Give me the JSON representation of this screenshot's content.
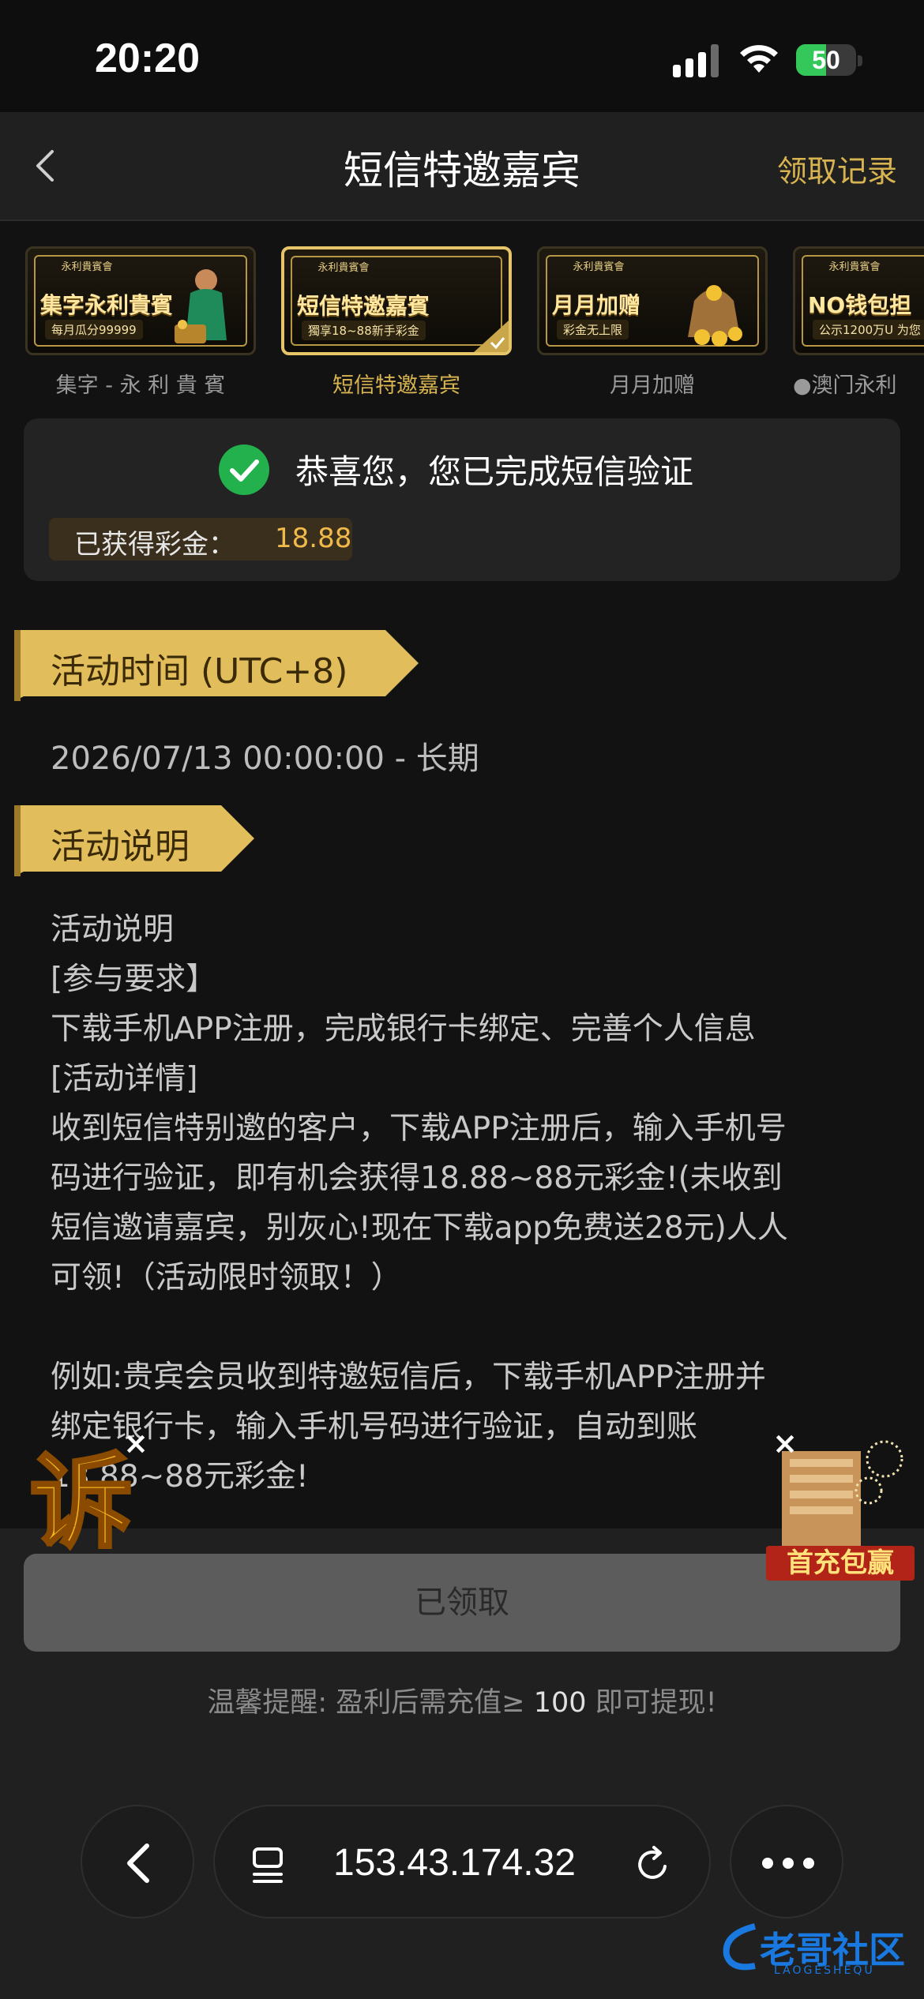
{
  "status_bar": {
    "time": "20:20",
    "battery": "50",
    "battery_level": 0.5
  },
  "header": {
    "title": "短信特邀嘉宾",
    "right_link": "领取记录"
  },
  "banners": [
    {
      "brand": "永利貴賓會",
      "main": "集字永利貴賓",
      "sub": "每月瓜分99999",
      "label": "集字 - 永 利 貴 賓"
    },
    {
      "brand": "永利貴賓會",
      "main": "短信特邀嘉賓",
      "sub": "獨享18~88新手彩金",
      "label": "短信特邀嘉宾"
    },
    {
      "brand": "永利貴賓會",
      "main": "月月加赠",
      "sub": "彩金无上限",
      "label": "月月加赠"
    },
    {
      "brand": "永利貴賓會",
      "main": "NO钱包担",
      "sub": "公示1200万U 为您",
      "label": "●澳门永利"
    }
  ],
  "verify": {
    "message": "恭喜您，您已完成短信验证",
    "bonus_label": "已获得彩金：",
    "bonus_value": "18.88"
  },
  "sections": {
    "time_title": "活动时间 (UTC+8)",
    "time_value": "2026/07/13 00:00:00 - 长期",
    "desc_title": "活动说明"
  },
  "description_lines": [
    "活动说明",
    "[参与要求】",
    "下载手机APP注册，完成银行卡绑定、完善个人信息",
    "[活动详情]",
    "收到短信特别邀的客户，下载APP注册后，输入手机号",
    "码进行验证，即有机会获得18.88~88元彩金!(未收到",
    "短信邀请嘉宾，别灰心!现在下载app免费送28元)人人",
    "可领!（活动限时领取！）",
    "",
    "例如:贵宾会员收到特邀短信后，下载手机APP注册并",
    "绑定银行卡，输入手机号码进行验证，自动到账",
    "18.88~88元彩金!"
  ],
  "floaters": {
    "left_char": "诉",
    "right_text": "首充包赢",
    "close": "×"
  },
  "footer": {
    "claimed_label": "已领取",
    "reminder_prefix": "温馨提醒: 盈利后需充值≥ ",
    "reminder_amount": "100",
    "reminder_suffix": " 即可提现!"
  },
  "browser": {
    "url": "153.43.174.32"
  },
  "watermark": {
    "text": "老哥社区",
    "sub": "LAOGESHEQU"
  },
  "colors": {
    "gold": "#d8b451",
    "bonus": "#f0b94a",
    "check_green": "#22b14c"
  }
}
